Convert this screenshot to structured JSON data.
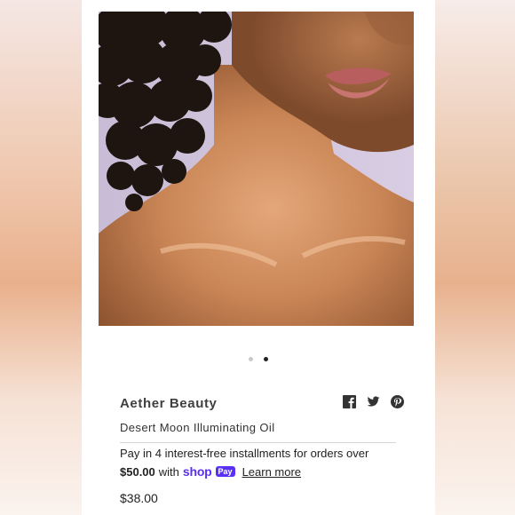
{
  "product": {
    "brand": "Aether Beauty",
    "name": "Desert Moon Illuminating Oil",
    "price": "$38.00"
  },
  "carousel": {
    "count": 2,
    "active_index": 1
  },
  "social": {
    "icons": [
      "facebook-icon",
      "twitter-icon",
      "pinterest-icon"
    ]
  },
  "installments": {
    "line1": "Pay in 4 interest-free installments for orders over",
    "amount": "$50.00",
    "with_text": "with",
    "shop_logo_text": "shop",
    "pay_badge": "Pay",
    "learn_more": "Learn more"
  },
  "colors": {
    "shop_purple": "#5a31f4",
    "text": "#222222"
  }
}
